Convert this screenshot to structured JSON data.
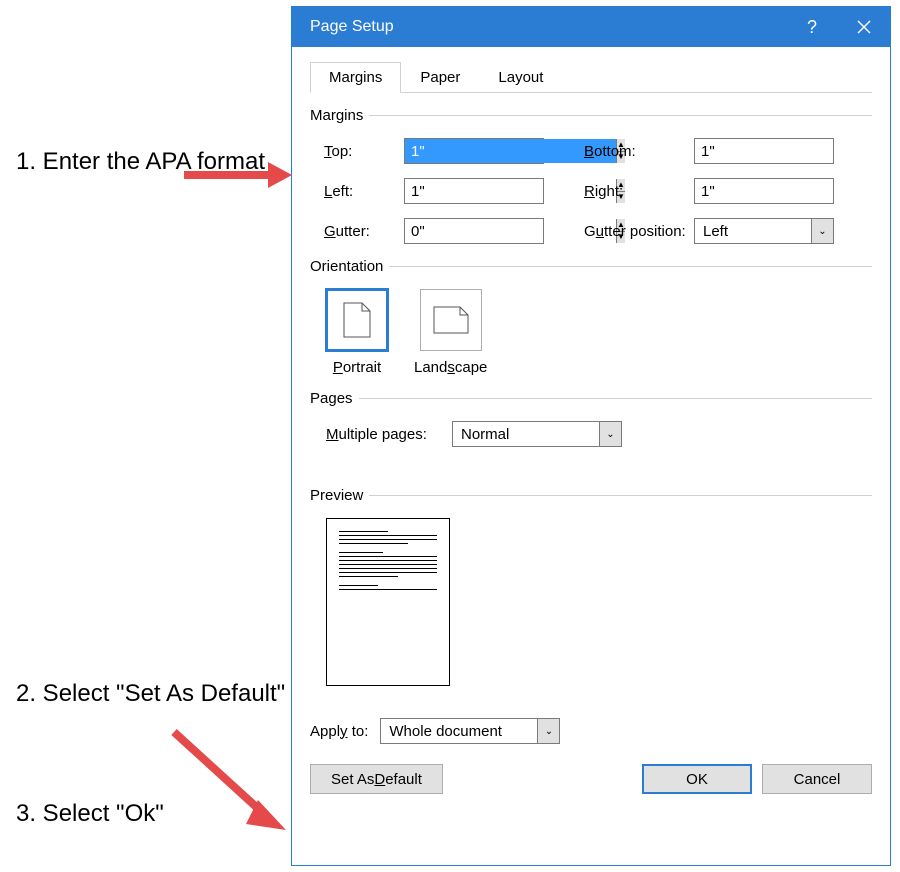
{
  "annotations": {
    "step1": "1. Enter the APA format",
    "step2": "2. Select \"Set As Default\"",
    "step3": "3. Select \"Ok\""
  },
  "dialog": {
    "title": "Page Setup",
    "tabs": [
      "Margins",
      "Paper",
      "Layout"
    ],
    "margins": {
      "header": "Margins",
      "top_label": "Top:",
      "top_value": "1\"",
      "bottom_label": "Bottom:",
      "bottom_value": "1\"",
      "left_label": "Left:",
      "left_value": "1\"",
      "right_label": "Right:",
      "right_value": "1\"",
      "gutter_label": "Gutter:",
      "gutter_value": "0\"",
      "gutter_pos_label": "Gutter position:",
      "gutter_pos_value": "Left"
    },
    "orientation": {
      "header": "Orientation",
      "portrait_label": "Portrait",
      "landscape_label": "Landscape"
    },
    "pages": {
      "header": "Pages",
      "label": "Multiple pages:",
      "value": "Normal"
    },
    "preview": {
      "header": "Preview"
    },
    "apply_to": {
      "label": "Apply to:",
      "value": "Whole document"
    },
    "buttons": {
      "set_default": "Set As Default",
      "ok": "OK",
      "cancel": "Cancel"
    }
  }
}
